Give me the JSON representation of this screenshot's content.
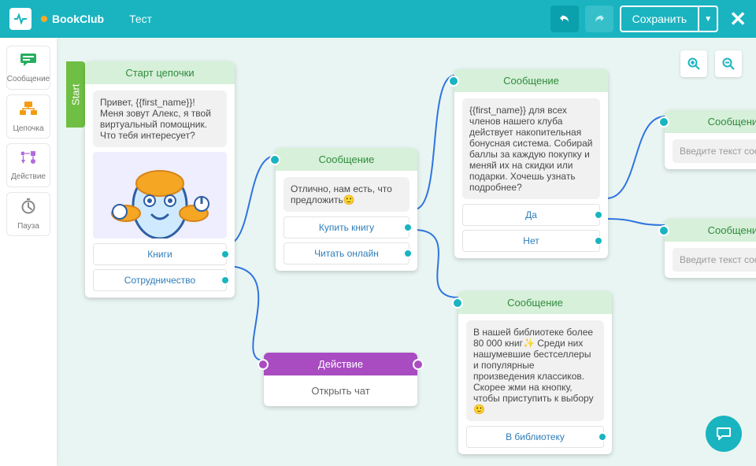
{
  "header": {
    "project": "BookClub",
    "page": "Тест",
    "save": "Сохранить",
    "start_tab": "Start"
  },
  "palette": {
    "message": "Сообщение",
    "chain": "Цепочка",
    "action": "Действие",
    "pause": "Пауза"
  },
  "nodes": {
    "start": {
      "title": "Старт цепочки",
      "text": "Привет, {{first_name}}! Меня зовут Алекс, я твой виртуальный помощник. Что тебя интересует?",
      "opt1": "Книги",
      "opt2": "Сотрудничество"
    },
    "msg1": {
      "title": "Сообщение",
      "text": "Отлично, нам есть, что предложить🙂",
      "opt1": "Купить книгу",
      "opt2": "Читать онлайн"
    },
    "msg2": {
      "title": "Сообщение",
      "text": "{{first_name}} для всех членов нашего клуба действует накопительная бонусная система. Собирай баллы за каждую покупку и меняй их на скидки или подарки. Хочешь узнать подробнее?",
      "opt1": "Да",
      "opt2": "Нет"
    },
    "msg3": {
      "title": "Сообщение",
      "text": "В нашей библиотеке более 80 000 книг✨ Среди них нашумевшие бестселлеры и популярные произведения классиков. Скорее жми на кнопку, чтобы приступить к выбору🙂",
      "opt1": "В библиотеку"
    },
    "msg4": {
      "title": "Сообщение",
      "placeholder": "Введите текст сообщен"
    },
    "msg5": {
      "title": "Сообщение",
      "placeholder": "Введите текст сообщен"
    },
    "action": {
      "title": "Действие",
      "text": "Открыть чат"
    }
  }
}
